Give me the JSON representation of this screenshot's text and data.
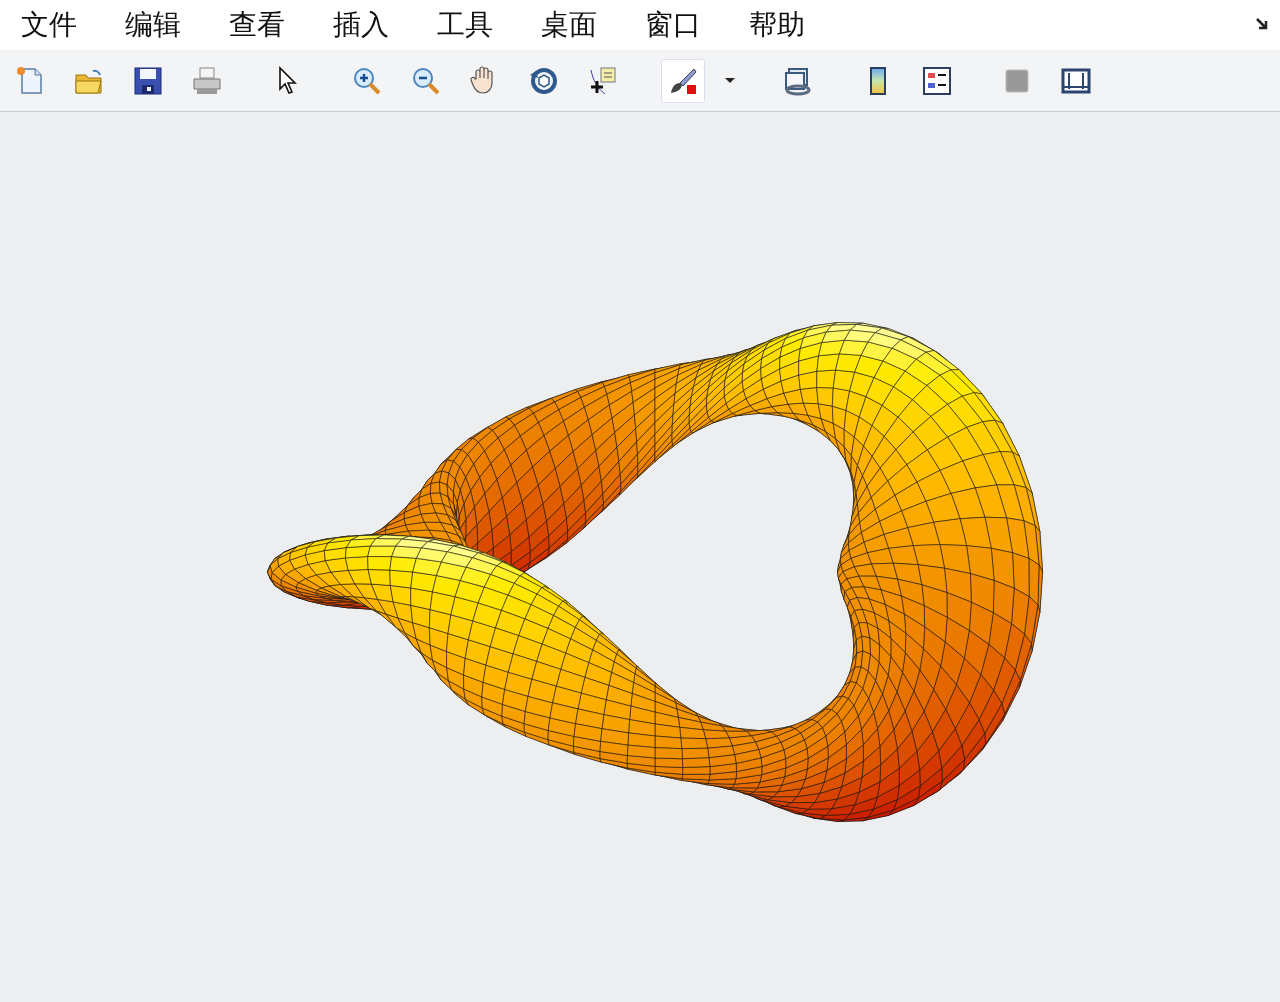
{
  "menu_bar": {
    "items": [
      "文件",
      "编辑",
      "查看",
      "插入",
      "工具",
      "桌面",
      "窗口",
      "帮助"
    ]
  },
  "toolbar": {
    "groups": [
      [
        {
          "kind": "new",
          "selected": false
        },
        {
          "kind": "open",
          "selected": false
        },
        {
          "kind": "save",
          "selected": false
        },
        {
          "kind": "print",
          "selected": false
        }
      ],
      [
        {
          "kind": "pointer",
          "selected": false
        }
      ],
      [
        {
          "kind": "zoom-in",
          "selected": false
        },
        {
          "kind": "zoom-out",
          "selected": false
        },
        {
          "kind": "pan",
          "selected": false
        },
        {
          "kind": "rotate",
          "selected": false
        },
        {
          "kind": "data-cursor",
          "selected": false
        }
      ],
      [
        {
          "kind": "brush",
          "selected": true
        },
        {
          "kind": "dropdown",
          "selected": false
        }
      ],
      [
        {
          "kind": "link",
          "selected": false
        }
      ],
      [
        {
          "kind": "colorbar",
          "selected": false
        },
        {
          "kind": "legend",
          "selected": false
        }
      ],
      [
        {
          "kind": "hide-tools",
          "selected": false
        },
        {
          "kind": "plot-tools",
          "selected": false
        }
      ]
    ]
  }
}
